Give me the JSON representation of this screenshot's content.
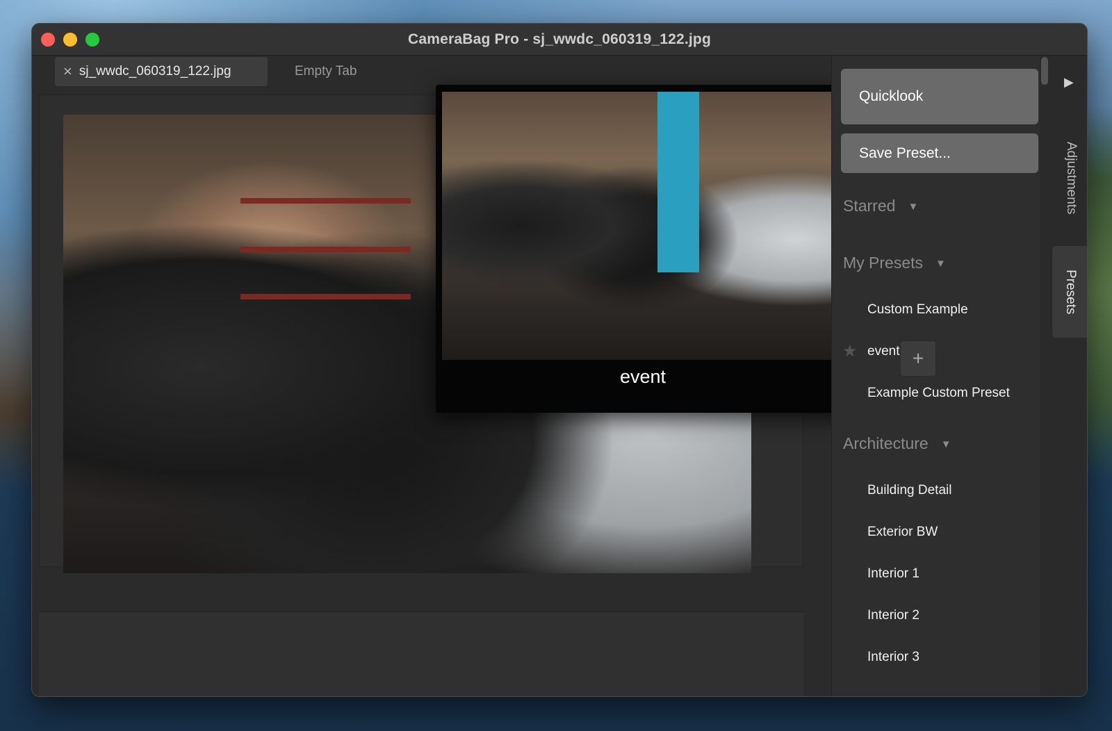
{
  "window": {
    "title": "CameraBag Pro - sj_wwdc_060319_122.jpg"
  },
  "tabs": [
    {
      "label": "sj_wwdc_060319_122.jpg",
      "close_icon": "×",
      "active": true
    },
    {
      "label": "Empty Tab",
      "active": false
    }
  ],
  "quicklook_popup": {
    "caption": "event"
  },
  "sidebar": {
    "quicklook_button": "Quicklook",
    "save_preset_button": "Save Preset...",
    "sections": [
      {
        "label": "Starred",
        "caret": "▼",
        "items": []
      },
      {
        "label": "My Presets",
        "caret": "▼",
        "items": [
          "Custom Example",
          "event",
          "Example Custom Preset"
        ]
      },
      {
        "label": "Architecture",
        "caret": "▼",
        "items": [
          "Building Detail",
          "Exterior BW",
          "Interior 1",
          "Interior 2",
          "Interior 3"
        ]
      }
    ],
    "star_icon": "★",
    "add_icon": "+"
  },
  "side_tabs": {
    "adjustments": "Adjustments",
    "presets": "Presets",
    "expand_icon": "▶"
  },
  "controls": {
    "collapse_icon": "▼",
    "prev_icon": "<",
    "next_icon": ">",
    "power_icon": "⏻",
    "close_icon": "✕"
  }
}
